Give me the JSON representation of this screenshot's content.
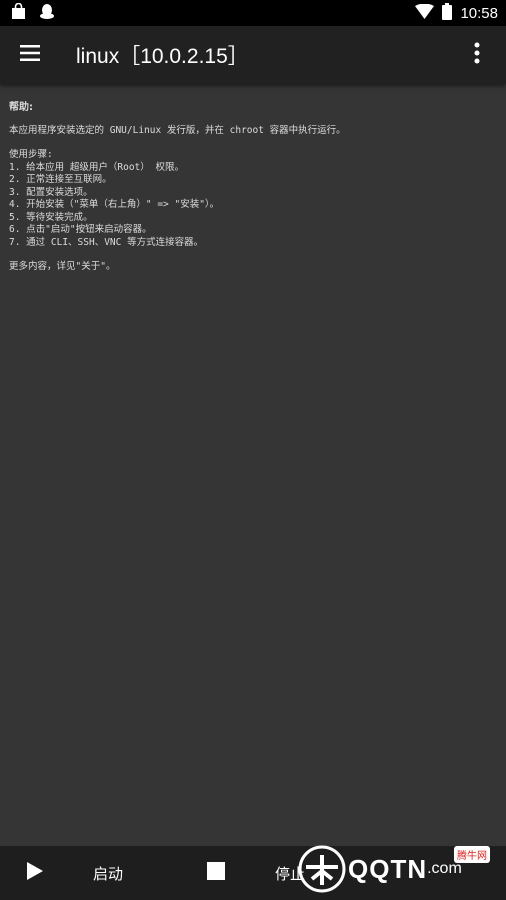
{
  "status_bar": {
    "time": "10:58",
    "icons_left": [
      "shopping-bag-icon",
      "qq-penguin-icon"
    ],
    "icons_right": [
      "wifi-icon",
      "battery-icon"
    ]
  },
  "app_bar": {
    "title": "linux［10.0.2.15］",
    "menu_icon": "hamburger-menu-icon",
    "overflow_icon": "more-vert-icon"
  },
  "help": {
    "heading": "帮助:",
    "intro": "本应用程序安装选定的 GNU/Linux 发行版，并在 chroot 容器中执行运行。",
    "steps_title": "使用步骤:",
    "steps": [
      "1. 给本应用 超级用户（Root） 权限。",
      "2. 正常连接至互联网。",
      "3. 配置安装选项。",
      "4. 开始安装（\"菜单（右上角）\" => \"安装\"）。",
      "5. 等待安装完成。",
      "6. 点击\"启动\"按钮来启动容器。",
      "7. 通过 CLI、SSH、VNC 等方式连接容器。"
    ],
    "more": "更多内容，详见\"关于\"。"
  },
  "bottom_bar": {
    "start_label": "启动",
    "stop_label": "停止",
    "start_icon": "play-icon",
    "stop_icon": "stop-icon"
  },
  "watermark": {
    "text": "QQTN",
    "suffix": ".com",
    "badge": "腾牛网"
  }
}
